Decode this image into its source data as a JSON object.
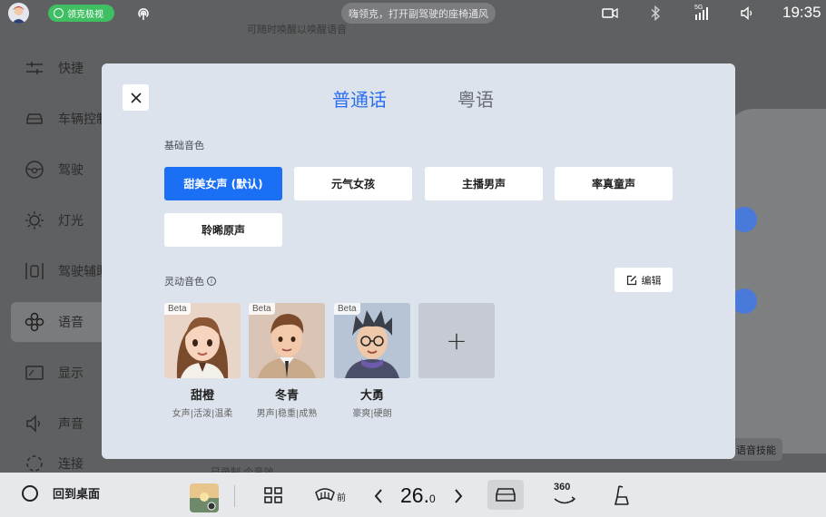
{
  "status_bar": {
    "brand_label": "领克极视",
    "voice_hint": "嗨领克，打开副驾驶的座椅通风",
    "signal_label": "5G",
    "time": "19:35"
  },
  "background": {
    "faded_hint": "可随时唤醒以唤醒语音",
    "faded_item": "已录制 个音效",
    "skill_button": "语音技能",
    "sidebar": [
      {
        "label": "快捷",
        "icon": "sliders-icon"
      },
      {
        "label": "车辆控制",
        "icon": "car-icon"
      },
      {
        "label": "驾驶",
        "icon": "steering-wheel-icon"
      },
      {
        "label": "灯光",
        "icon": "sun-icon"
      },
      {
        "label": "驾驶辅助",
        "icon": "lane-assist-icon"
      },
      {
        "label": "语音",
        "icon": "voice-icon"
      },
      {
        "label": "显示",
        "icon": "display-icon"
      },
      {
        "label": "声音",
        "icon": "speaker-icon"
      },
      {
        "label": "连接",
        "icon": "link-icon"
      }
    ],
    "sidebar_active_index": 5
  },
  "modal": {
    "tabs": [
      {
        "label": "普通话",
        "active": true
      },
      {
        "label": "粤语",
        "active": false
      }
    ],
    "basic_section_label": "基础音色",
    "basic_voices": [
      {
        "label": "甜美女声 (默认)",
        "selected": true
      },
      {
        "label": "元气女孩",
        "selected": false
      },
      {
        "label": "主播男声",
        "selected": false
      },
      {
        "label": "率真童声",
        "selected": false
      },
      {
        "label": "聆晞原声",
        "selected": false
      }
    ],
    "dynamic_section_label": "灵动音色",
    "edit_label": "编辑",
    "characters": [
      {
        "name": "甜橙",
        "tags": "女声|活泼|温柔",
        "badge": "Beta"
      },
      {
        "name": "冬青",
        "tags": "男声|稳重|成熟",
        "badge": "Beta"
      },
      {
        "name": "大勇",
        "tags": "豪爽|硬朗",
        "badge": "Beta"
      }
    ],
    "add_label": "+"
  },
  "dock": {
    "home_label": "回到桌面",
    "defrost_label": "前",
    "temperature_int": "26.",
    "temperature_dec": "0",
    "view360_label": "360"
  },
  "colors": {
    "accent": "#1a6ff4",
    "brand_green": "#3fbf62",
    "modal_bg": "#dde3ec"
  }
}
